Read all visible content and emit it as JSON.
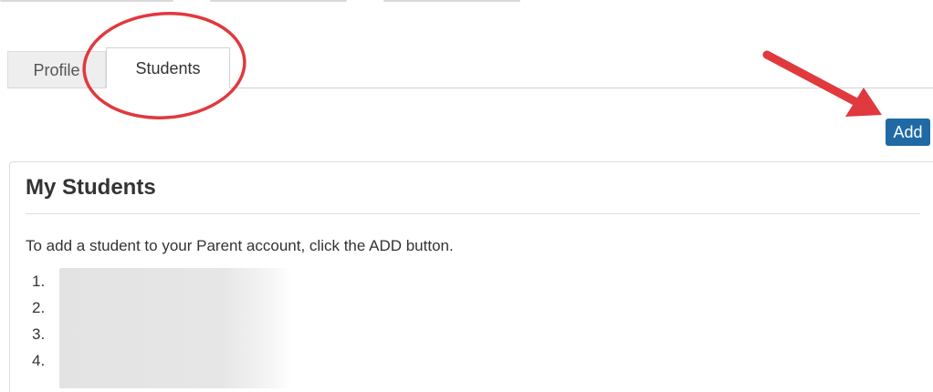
{
  "tabs": [
    {
      "label": "Profile"
    },
    {
      "label": "Students"
    }
  ],
  "toolbar": {
    "add_label": "Add"
  },
  "panel": {
    "title": "My Students",
    "instructions": "To add a student to your Parent account, click the ADD button.",
    "students": [
      {
        "number": "1."
      },
      {
        "number": "2."
      },
      {
        "number": "3."
      },
      {
        "number": "4."
      }
    ]
  },
  "colors": {
    "accent": "#1f6aa5",
    "annotation": "#e0393e"
  }
}
